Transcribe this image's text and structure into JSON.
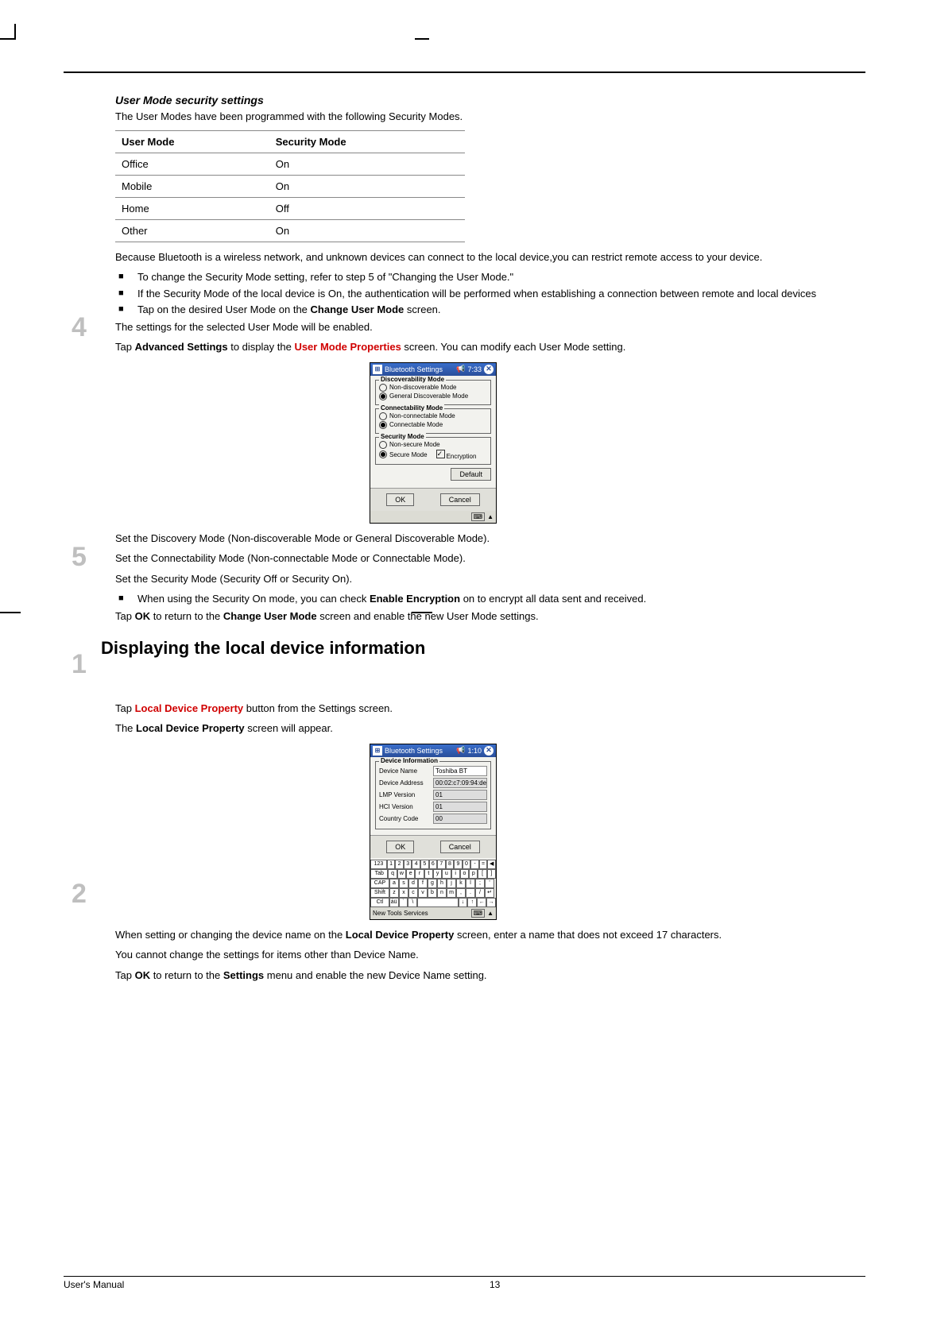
{
  "heading_security": "User Mode security settings",
  "intro_security": "The User Modes have been programmed with the following Security Modes.",
  "table": {
    "h1": "User Mode",
    "h2": "Security Mode",
    "rows": [
      {
        "mode": "Office",
        "sec": "On"
      },
      {
        "mode": "Mobile",
        "sec": "On"
      },
      {
        "mode": "Home",
        "sec": "Off"
      },
      {
        "mode": "Other",
        "sec": "On"
      }
    ]
  },
  "because": "Because Bluetooth is a wireless network, and unknown devices can connect to the local device,you can restrict remote access to your device.",
  "bullets1": [
    "To change the Security Mode setting, refer to step 5 of \"Changing the User Mode.\"",
    "If the Security Mode of the local device is On, the authentication will be performed when establishing a connection between remote and local devices",
    "Tap on the desired User Mode on the <b>Change User Mode</b> screen."
  ],
  "after_bullets1": "The settings for the selected User Mode will be enabled.",
  "step4": "4",
  "step4_text": {
    "pre": "Tap ",
    "b1": "Advanced Settings",
    "mid": " to display the ",
    "red": "User Mode Properties",
    "post": " screen. You can modify each User Mode setting."
  },
  "shot1": {
    "title": "Bluetooth Settings",
    "time": "7:33",
    "fs1": "Discoverability Mode",
    "fs1_o1": "Non-discoverable Mode",
    "fs1_o2": "General Discoverable Mode",
    "fs2": "Connectability Mode",
    "fs2_o1": "Non-connectable Mode",
    "fs2_o2": "Connectable Mode",
    "fs3": "Security Mode",
    "fs3_o1": "Non-secure Mode",
    "fs3_o2": "Secure Mode",
    "enc": "Encryption",
    "default": "Default",
    "ok": "OK",
    "cancel": "Cancel"
  },
  "set_lines": [
    "Set the Discovery Mode (Non-discoverable Mode or General Discoverable Mode).",
    "Set the Connectability Mode (Non-connectable Mode or Connectable Mode).",
    "Set the Security Mode (Security Off or Security On)."
  ],
  "bullets2": [
    "When using the Security On mode, you can check <b>Enable Encryption</b> on to encrypt all data sent and received."
  ],
  "step5": "5",
  "step5_text": {
    "pre": "Tap ",
    "b1": "OK",
    "mid": " to return to the ",
    "b2": "Change User Mode",
    "post": " screen and enable the new User Mode settings."
  },
  "section2": "Displaying the local device information",
  "step1": "1",
  "step1_text": {
    "pre": "Tap ",
    "red": "Local Device Property",
    "post": " button from the Settings screen."
  },
  "step1_after": {
    "pre": "The ",
    "b": "Local Device Property",
    "post": " screen will appear."
  },
  "shot2": {
    "title": "Bluetooth Settings",
    "time": "1:10",
    "fs": "Device Information",
    "rows": [
      {
        "lbl": "Device Name",
        "val": "Toshiba BT",
        "editable": true
      },
      {
        "lbl": "Device Address",
        "val": "00:02:c7:09:94:de",
        "editable": false
      },
      {
        "lbl": "LMP Version",
        "val": "01",
        "editable": false
      },
      {
        "lbl": "HCI Version",
        "val": "01",
        "editable": false
      },
      {
        "lbl": "Country Code",
        "val": "00",
        "editable": false
      }
    ],
    "ok": "OK",
    "cancel": "Cancel",
    "menubar": "New Tools Services"
  },
  "when_setting": {
    "pre": "When setting or changing the device name on the ",
    "b": "Local Device Property",
    "post": " screen, enter a name that does not exceed 17 characters."
  },
  "cannot_change": "You cannot change the settings for items other than Device Name.",
  "step2": "2",
  "step2_text": {
    "pre": "Tap ",
    "b1": "OK",
    "mid": " to return to the ",
    "b2": "Settings",
    "post": " menu and enable the new Device Name setting."
  },
  "footer_left": "User's Manual",
  "footer_center": "13"
}
